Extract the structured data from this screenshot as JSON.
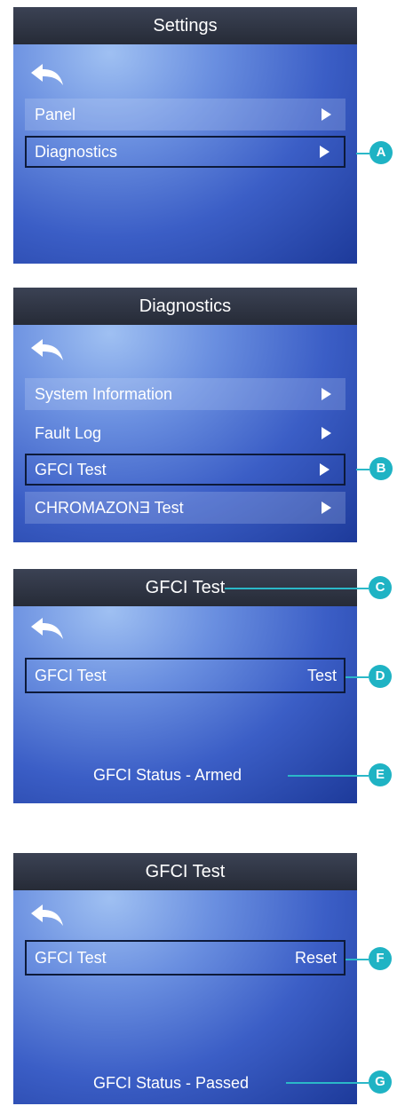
{
  "screens": [
    {
      "title": "Settings",
      "items": [
        {
          "label": "Panel"
        },
        {
          "label": "Diagnostics"
        }
      ]
    },
    {
      "title": "Diagnostics",
      "items": [
        {
          "label": "System Information"
        },
        {
          "label": "Fault Log"
        },
        {
          "label": "GFCI Test"
        },
        {
          "label": "CHROMAZONƎ Test"
        }
      ]
    },
    {
      "title": "GFCI Test",
      "row_label": "GFCI Test",
      "row_value": "Test",
      "status": "GFCI Status - Armed"
    },
    {
      "title": "GFCI Test",
      "row_label": "GFCI Test",
      "row_value": "Reset",
      "status": "GFCI Status - Passed"
    }
  ],
  "callouts": [
    "A",
    "B",
    "C",
    "D",
    "E",
    "F",
    "G"
  ],
  "colors": {
    "callout": "#1fb3c4",
    "titlebar": "#2f3543",
    "screen_light": "#9fc0f2",
    "screen_dark": "#1d3a9a"
  },
  "icons": {
    "back": "back-arrow-icon",
    "submenu": "submenu-arrow-icon"
  }
}
